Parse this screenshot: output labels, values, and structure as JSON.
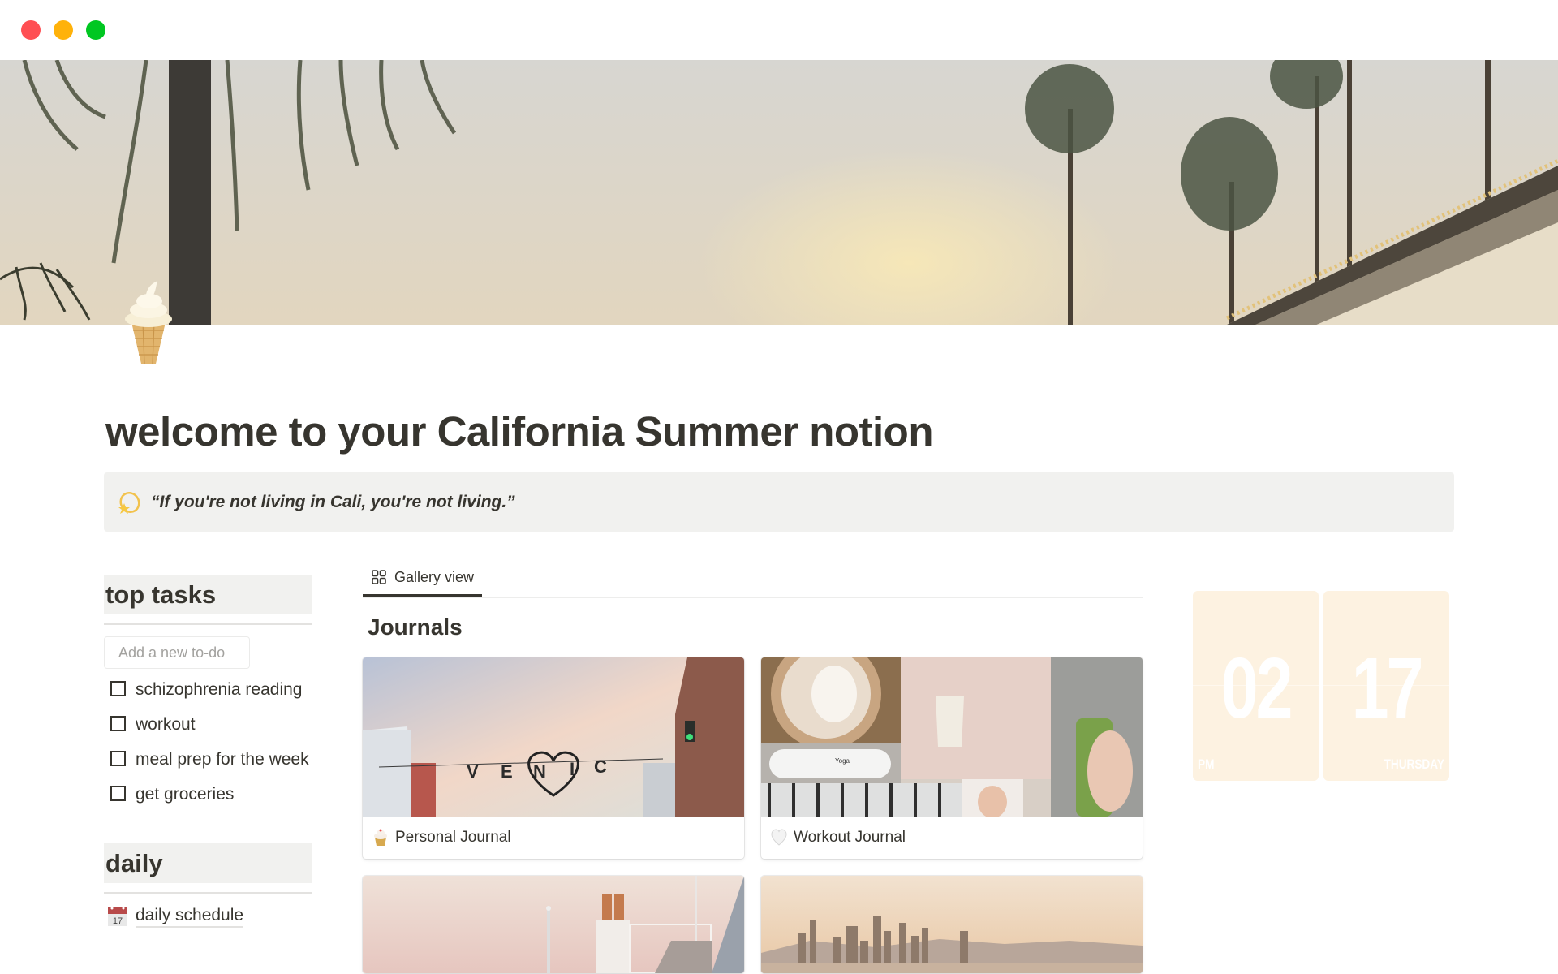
{
  "window": {
    "controls": [
      "close",
      "minimize",
      "maximize"
    ]
  },
  "page": {
    "cover_icon": "palm-trees-sunset-cover",
    "icon": "soft-ice-cream-icon",
    "title": "welcome to your California Summer notion",
    "callout": {
      "icon": "dizzy-star-icon",
      "text": "“If you're not living in Cali, you're not living.”"
    }
  },
  "top_tasks": {
    "heading": "top tasks",
    "input_placeholder": "Add a new to-do",
    "todos": [
      {
        "label": "schizophrenia reading",
        "checked": false
      },
      {
        "label": "workout",
        "checked": false
      },
      {
        "label": "meal prep for the week",
        "checked": false
      },
      {
        "label": "get groceries",
        "checked": false
      }
    ]
  },
  "daily": {
    "heading": "daily",
    "links": [
      {
        "icon": "calendar-icon",
        "icon_text": "17",
        "label": "daily schedule"
      }
    ]
  },
  "gallery": {
    "tabs": [
      {
        "label": "Gallery view",
        "icon": "grid-icon",
        "active": true
      }
    ],
    "title": "Journals",
    "cards": [
      {
        "label": "Personal Journal",
        "icon": "cupcake-icon",
        "cover": "venice-sign-sunset"
      },
      {
        "label": "Workout Journal",
        "icon": "white-heart-icon",
        "cover": "coffee-yoga-collage"
      },
      {
        "label": "",
        "icon": "",
        "cover": "pink-beach-house"
      },
      {
        "label": "",
        "icon": "",
        "cover": "la-skyline"
      }
    ]
  },
  "clock": {
    "hour": "02",
    "minute": "17",
    "meridiem": "PM",
    "weekday": "THURSDAY"
  },
  "colors": {
    "text": "#37352f",
    "callout_bg": "#f1f1ef",
    "clock_bg": "#fdf2e1",
    "traffic_red": "#ff4f53",
    "traffic_yellow": "#ffb20a",
    "traffic_green": "#00c721"
  }
}
